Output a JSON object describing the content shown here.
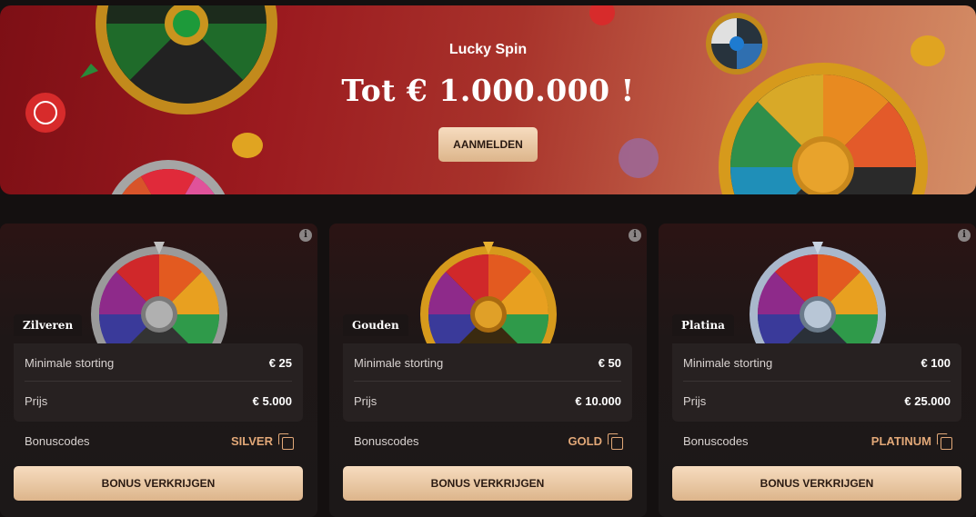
{
  "banner": {
    "title": "Lucky Spin",
    "headline": "Tot €  1.000.000 !",
    "button_label": "AANMELDEN"
  },
  "cards": [
    {
      "tier": "Zilveren",
      "min_deposit_label": "Minimale storting",
      "min_deposit_value": "€ 25",
      "prize_label": "Prijs",
      "prize_value": "€ 5.000",
      "codes_label": "Bonuscodes",
      "code": "SILVER",
      "button_label": "BONUS VERKRIJGEN",
      "rim_color": "#9a9a9a"
    },
    {
      "tier": "Gouden",
      "min_deposit_label": "Minimale storting",
      "min_deposit_value": "€ 50",
      "prize_label": "Prijs",
      "prize_value": "€ 10.000",
      "codes_label": "Bonuscodes",
      "code": "GOLD",
      "button_label": "BONUS VERKRIJGEN",
      "rim_color": "#d69a1c"
    },
    {
      "tier": "Platina",
      "min_deposit_label": "Minimale storting",
      "min_deposit_value": "€ 100",
      "prize_label": "Prijs",
      "prize_value": "€ 25.000",
      "codes_label": "Bonuscodes",
      "code": "PLATINUM",
      "button_label": "BONUS VERKRIJGEN",
      "rim_color": "#a9b8cc"
    }
  ],
  "icons": {
    "info": "info-icon",
    "copy": "copy-icon"
  },
  "colors": {
    "accent_button": "#e8c6a2",
    "code_text": "#e2a878"
  }
}
